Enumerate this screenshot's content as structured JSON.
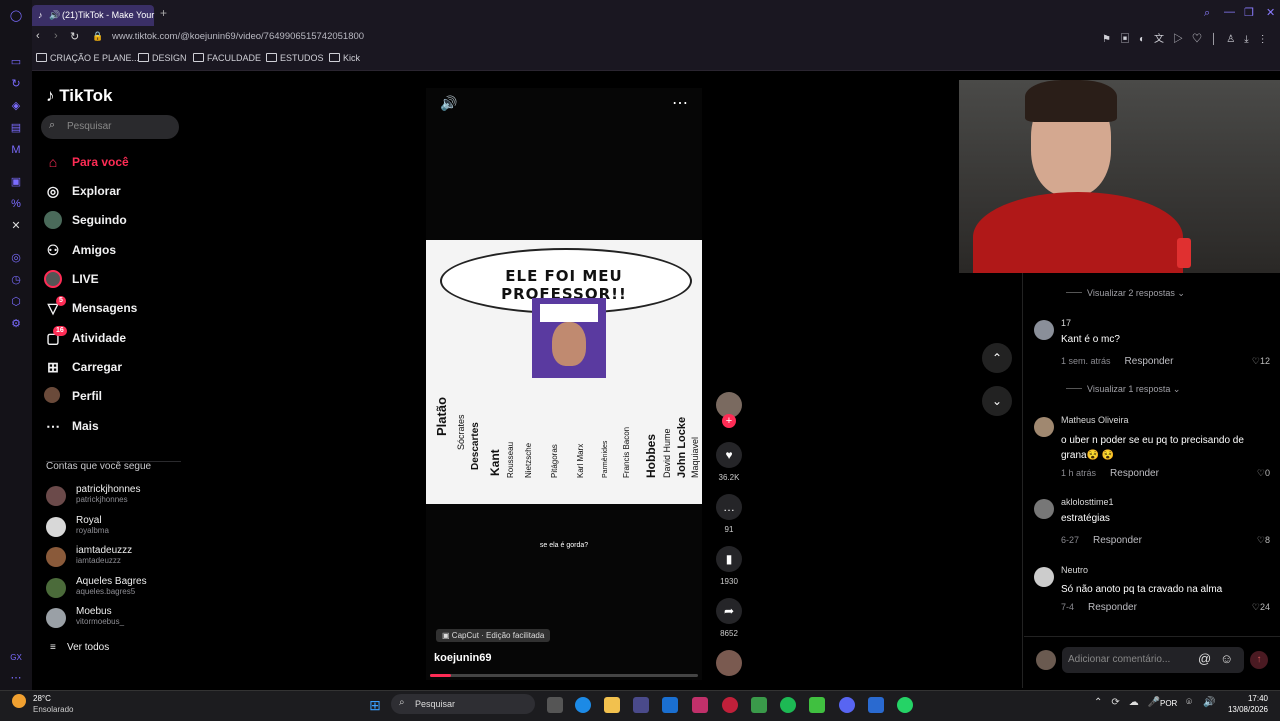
{
  "browser": {
    "tab_title": "(21)TikTok - Make Your",
    "url": "www.tiktok.com/@koejunin69/video/7649906515742051800",
    "bookmarks": [
      "CRIAÇÃO E PLANE...",
      "DESIGN",
      "FACULDADE",
      "ESTUDOS",
      "Kick"
    ]
  },
  "sidebar": {
    "logo": "TikTok",
    "search_placeholder": "Pesquisar",
    "nav": [
      {
        "label": "Para você",
        "icon": "home-icon",
        "active": true
      },
      {
        "label": "Explorar",
        "icon": "compass-icon"
      },
      {
        "label": "Seguindo",
        "icon": "following-avatar-icon"
      },
      {
        "label": "Amigos",
        "icon": "friends-icon"
      },
      {
        "label": "LIVE",
        "icon": "live-icon"
      },
      {
        "label": "Mensagens",
        "icon": "messages-icon",
        "badge": "5"
      },
      {
        "label": "Atividade",
        "icon": "activity-icon",
        "badge": "16"
      },
      {
        "label": "Carregar",
        "icon": "upload-icon"
      },
      {
        "label": "Perfil",
        "icon": "profile-icon"
      },
      {
        "label": "Mais",
        "icon": "more-icon"
      }
    ],
    "following_title": "Contas que você segue",
    "following": [
      {
        "name": "patrickjhonnes",
        "handle": "patrickjhonnes",
        "color": "#6b4a4a"
      },
      {
        "name": "Royal",
        "handle": "royalbma",
        "color": "#d8d8d8"
      },
      {
        "name": "iamtadeuzzz",
        "handle": "iamtadeuzzz",
        "color": "#8a5a3a"
      },
      {
        "name": "Aqueles Bagres",
        "handle": "aqueles.bagres5",
        "color": "#4b6b3a"
      },
      {
        "name": "Moebus",
        "handle": "vitormoebus_",
        "color": "#9aa0a6"
      }
    ],
    "see_all": "Ver todos"
  },
  "video": {
    "title_text": "ELE FOI MEU PROFESSOR!!",
    "philosophers": [
      "Platão",
      "Sócrates",
      "Descartes",
      "Kant",
      "Rousseau",
      "Nietzsche",
      "Pitágoras",
      "Karl Marx",
      "Parmênides",
      "Francis Bacon",
      "Hobbes",
      "David Hume",
      "John Locke",
      "Maquiavel"
    ],
    "caption": "se ela é gorda?",
    "capcut": "CapCut · Edição facilitada",
    "author": "koejunin69",
    "progress": 0.08
  },
  "actions": {
    "likes": "36.2K",
    "comments": "91",
    "saves": "1930",
    "shares": "8652"
  },
  "comments": {
    "view_replies_top": "Visualizar 2 respostas",
    "items": [
      {
        "user": "17",
        "text": "Kant é o mc?",
        "time": "1 sem. atrás",
        "reply": "Responder",
        "likes": "12",
        "color": "#8a8f99"
      },
      {
        "view_replies": "Visualizar 1 resposta"
      },
      {
        "user": "Matheus Oliveira",
        "text": "o uber n poder se eu pq to precisando de",
        "text2": "grana😵 😵",
        "time": "1 h atrás",
        "reply": "Responder",
        "likes": "0",
        "color": "#a08870"
      },
      {
        "user": "aklolosttime1",
        "text": "estratégias",
        "time": "6-27",
        "reply": "Responder",
        "likes": "8",
        "color": "#777"
      },
      {
        "user": "Neutro",
        "text": "Só não anoto pq ta cravado na alma",
        "time": "7-4",
        "reply": "Responder",
        "likes": "24",
        "color": "#ccc"
      }
    ],
    "input_placeholder": "Adicionar comentário..."
  },
  "taskbar": {
    "weather_temp": "28°C",
    "weather_desc": "Ensolarado",
    "search": "Pesquisar",
    "lang": "POR",
    "time": "17:40",
    "date": "13/08/2026"
  }
}
